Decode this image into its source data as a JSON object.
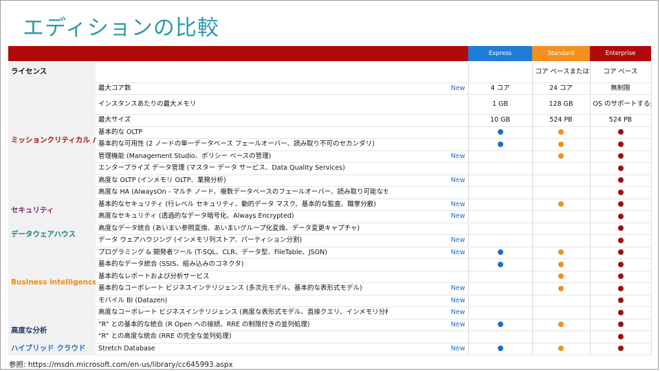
{
  "title": "エディションの比較",
  "columns": [
    {
      "label": "Express",
      "color": "#1f7dd8"
    },
    {
      "label": "Standard",
      "color": "#f3901e"
    },
    {
      "label": "Enterprise",
      "color": "#b10a0a"
    }
  ],
  "dot_colors": {
    "express": "#1c6fc6",
    "standard": "#f3901e",
    "enterprise": "#9b1010"
  },
  "category_colors": {
    "license": "#111111",
    "mission_critical": "#a31010",
    "security": "#7a2a6c",
    "data_warehouse": "#1a7a7a",
    "bi": "#f08a10",
    "advanced_analytics": "#1f3864",
    "hybrid_cloud": "#1f6fc0"
  },
  "license_row": {
    "category": "ライセンス",
    "express": "",
    "standard": "コア ベースまたはサーバー + CAL",
    "enterprise": "コア ベース"
  },
  "groups": [
    {
      "key": "mission_critical",
      "category": "ミッションクリティカル パフォーマンス",
      "rows": [
        {
          "feature": "最大コア数",
          "new": "New",
          "express": "4 コア",
          "standard": "24 コア",
          "enterprise": "無制限"
        },
        {
          "feature": "インスタンスあたりの最大メモリ",
          "new": "",
          "express": "1 GB",
          "standard": "128 GB",
          "enterprise": "OS のサポートする最大"
        },
        {
          "feature": "最大サイズ",
          "new": "",
          "express": "10 GB",
          "standard": "524 PB",
          "enterprise": "524 PB"
        },
        {
          "feature": "基本的な OLTP",
          "new": "",
          "express": "dot",
          "standard": "dot",
          "enterprise": "dot"
        },
        {
          "feature": "基本的な可用性 (2 ノードの単一データベース フェールオーバー、読み取り不可のセカンダリ)",
          "new": "",
          "express": "dot",
          "standard": "dot",
          "enterprise": "dot"
        },
        {
          "feature": "管理機能 (Management Studio、ポリシー ベースの管理)",
          "new": "New",
          "express": "",
          "standard": "dot",
          "enterprise": "dot"
        },
        {
          "feature": "エンタープライズ データ管理 (マスター データ サービス、Data Quality Services)",
          "new": "",
          "express": "",
          "standard": "",
          "enterprise": "dot"
        },
        {
          "feature": "高度な OLTP (インメモリ OLTP、業務分析)",
          "new": "New",
          "express": "",
          "standard": "",
          "enterprise": "dot"
        },
        {
          "feature": "高度な HA (AlwaysOn - マルチ ノード、複数データベースのフェールオーバー、読み取り可能なセカンダリ)",
          "new": "",
          "express": "",
          "standard": "",
          "enterprise": "dot"
        }
      ]
    },
    {
      "key": "security",
      "category": "セキュリティ",
      "rows": [
        {
          "feature": "基本的なセキュリティ (行レベル セキュリティ、動的データ マスク、基本的な監査、職掌分散)",
          "new": "New",
          "express": "",
          "standard": "dot",
          "enterprise": "dot"
        },
        {
          "feature": "高度なセキュリティ (透過的なデータ暗号化、Always Encrypted)",
          "new": "New",
          "express": "",
          "standard": "",
          "enterprise": "dot"
        }
      ]
    },
    {
      "key": "data_warehouse",
      "category": "データウェアハウス",
      "rows": [
        {
          "feature": "高度なデータ統合 (あいまい参照変換、あいまいグループ化変換、データ変更キャプチャ)",
          "new": "",
          "express": "",
          "standard": "",
          "enterprise": "dot"
        },
        {
          "feature": "データ ウェアハウジング (インメモリ列ストア、パーティション分割)",
          "new": "New",
          "express": "",
          "standard": "",
          "enterprise": "dot"
        }
      ]
    },
    {
      "key": "bi",
      "category": "Business intelligence",
      "rows": [
        {
          "feature": "プログラミング & 開発者ツール (T-SQL、CLR、データ型、FileTable、JSON)",
          "new": "New",
          "express": "dot",
          "standard": "dot",
          "enterprise": "dot"
        },
        {
          "feature": "基本的なデータ統合 (SSIS、組み込みのコネクタ)",
          "new": "",
          "express": "dot",
          "standard": "dot",
          "enterprise": "dot"
        },
        {
          "feature": "基本的なレポートおよび分析サービス",
          "new": "",
          "express": "",
          "standard": "dot",
          "enterprise": "dot"
        },
        {
          "feature": "基本的なコーポレート ビジネスインテリジェンス (多次元モデル、基本的な表形式モデル)",
          "new": "New",
          "express": "",
          "standard": "dot",
          "enterprise": "dot"
        },
        {
          "feature": "モバイル BI (Datazen)",
          "new": "New",
          "express": "",
          "standard": "",
          "enterprise": "dot"
        },
        {
          "feature": "高度なコーポレート ビジネスインテリジェンス (高度な表形式モデル、直接クエリ、インメモリ分析、高度なデータ マイニング)",
          "new": "New",
          "express": "",
          "standard": "",
          "enterprise": "dot"
        }
      ]
    },
    {
      "key": "advanced_analytics",
      "category": "高度な分析",
      "rows": [
        {
          "feature": "“R” との基本的な統合 (R Open への接続、RRE の制限付きの並列処理)",
          "new": "New",
          "express": "dot",
          "standard": "dot",
          "enterprise": "dot"
        },
        {
          "feature": "“R” との高度な統合 (RRE の完全な並列処理)",
          "new": "",
          "express": "",
          "standard": "",
          "enterprise": "dot"
        }
      ]
    },
    {
      "key": "hybrid_cloud",
      "category": "ハイブリッド クラウド",
      "rows": [
        {
          "feature": "Stretch Database",
          "new": "New",
          "express": "dot",
          "standard": "dot",
          "enterprise": "dot"
        }
      ]
    }
  ],
  "footer": "参照: https://msdn.microsoft.com/en-us/library/cc645993.aspx"
}
